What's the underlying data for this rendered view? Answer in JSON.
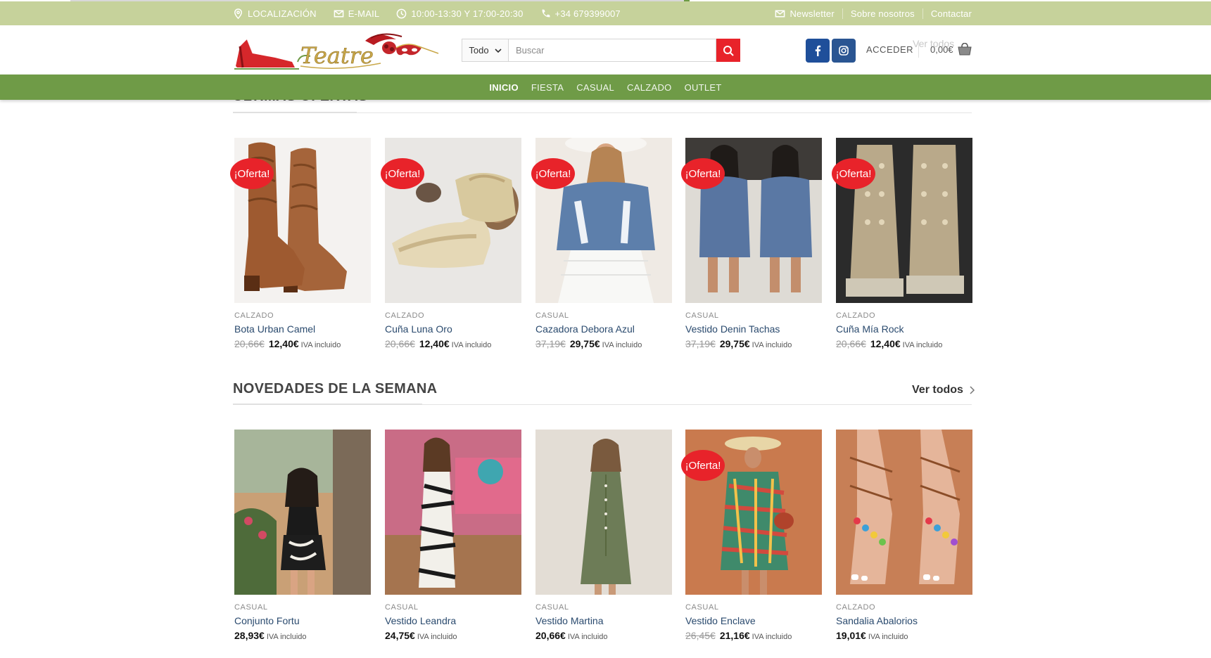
{
  "topbar": {
    "left": [
      {
        "icon": "location-icon",
        "label": "LOCALIZACIÓN"
      },
      {
        "icon": "mail-icon",
        "label": "E-MAIL"
      },
      {
        "icon": "clock-icon",
        "label": "10:00-13:30 Y 17:00-20:30"
      },
      {
        "icon": "phone-icon",
        "label": "+34 679399007"
      }
    ],
    "right": [
      {
        "icon": "mail-icon",
        "label": "Newsletter"
      },
      {
        "label": "Sobre nosotros"
      },
      {
        "label": "Contactar"
      }
    ]
  },
  "header": {
    "logo_text": "Teatre",
    "search_category": "Todo",
    "search_placeholder": "Buscar",
    "login_label": "ACCEDER",
    "ghost_text": "Ver todos",
    "cart_total": "0,00€"
  },
  "nav": {
    "items": [
      "INICIO",
      "FIESTA",
      "CASUAL",
      "CALZADO",
      "OUTLET"
    ],
    "active": "INICIO"
  },
  "sections": {
    "ofertas": {
      "title": "ÚLTIMAS OFERTAS",
      "products": [
        {
          "category": "CALZADO",
          "name": "Bota Urban Camel",
          "old_price": "20,66€",
          "price": "12,40€",
          "tax": "IVA incluido",
          "badge": "¡Oferta!"
        },
        {
          "category": "CALZADO",
          "name": "Cuña Luna Oro",
          "old_price": "20,66€",
          "price": "12,40€",
          "tax": "IVA incluido",
          "badge": "¡Oferta!"
        },
        {
          "category": "CASUAL",
          "name": "Cazadora Debora Azul",
          "old_price": "37,19€",
          "price": "29,75€",
          "tax": "IVA incluido",
          "badge": "¡Oferta!"
        },
        {
          "category": "CASUAL",
          "name": "Vestido Denin Tachas",
          "old_price": "37,19€",
          "price": "29,75€",
          "tax": "IVA incluido",
          "badge": "¡Oferta!"
        },
        {
          "category": "CALZADO",
          "name": "Cuña Mía Rock",
          "old_price": "20,66€",
          "price": "12,40€",
          "tax": "IVA incluido",
          "badge": "¡Oferta!"
        }
      ]
    },
    "novedades": {
      "title": "NOVEDADES DE LA SEMANA",
      "see_all": "Ver todos",
      "products": [
        {
          "category": "CASUAL",
          "name": "Conjunto Fortu",
          "old_price": "",
          "price": "28,93€",
          "tax": "IVA incluido",
          "badge": ""
        },
        {
          "category": "CASUAL",
          "name": "Vestido Leandra",
          "old_price": "",
          "price": "24,75€",
          "tax": "IVA incluido",
          "badge": ""
        },
        {
          "category": "CASUAL",
          "name": "Vestido Martina",
          "old_price": "",
          "price": "20,66€",
          "tax": "IVA incluido",
          "badge": ""
        },
        {
          "category": "CASUAL",
          "name": "Vestido Enclave",
          "old_price": "26,45€",
          "price": "21,16€",
          "tax": "IVA incluido",
          "badge": "¡Oferta!"
        },
        {
          "category": "CALZADO",
          "name": "Sandalia Abalorios",
          "old_price": "",
          "price": "19,01€",
          "tax": "IVA incluido",
          "badge": ""
        }
      ]
    }
  },
  "colors": {
    "topbar": "#c6d29b",
    "nav": "#6f9b47",
    "accent_red": "#e8232a",
    "facebook": "#1f4f9a",
    "link": "#2a4a6e"
  }
}
